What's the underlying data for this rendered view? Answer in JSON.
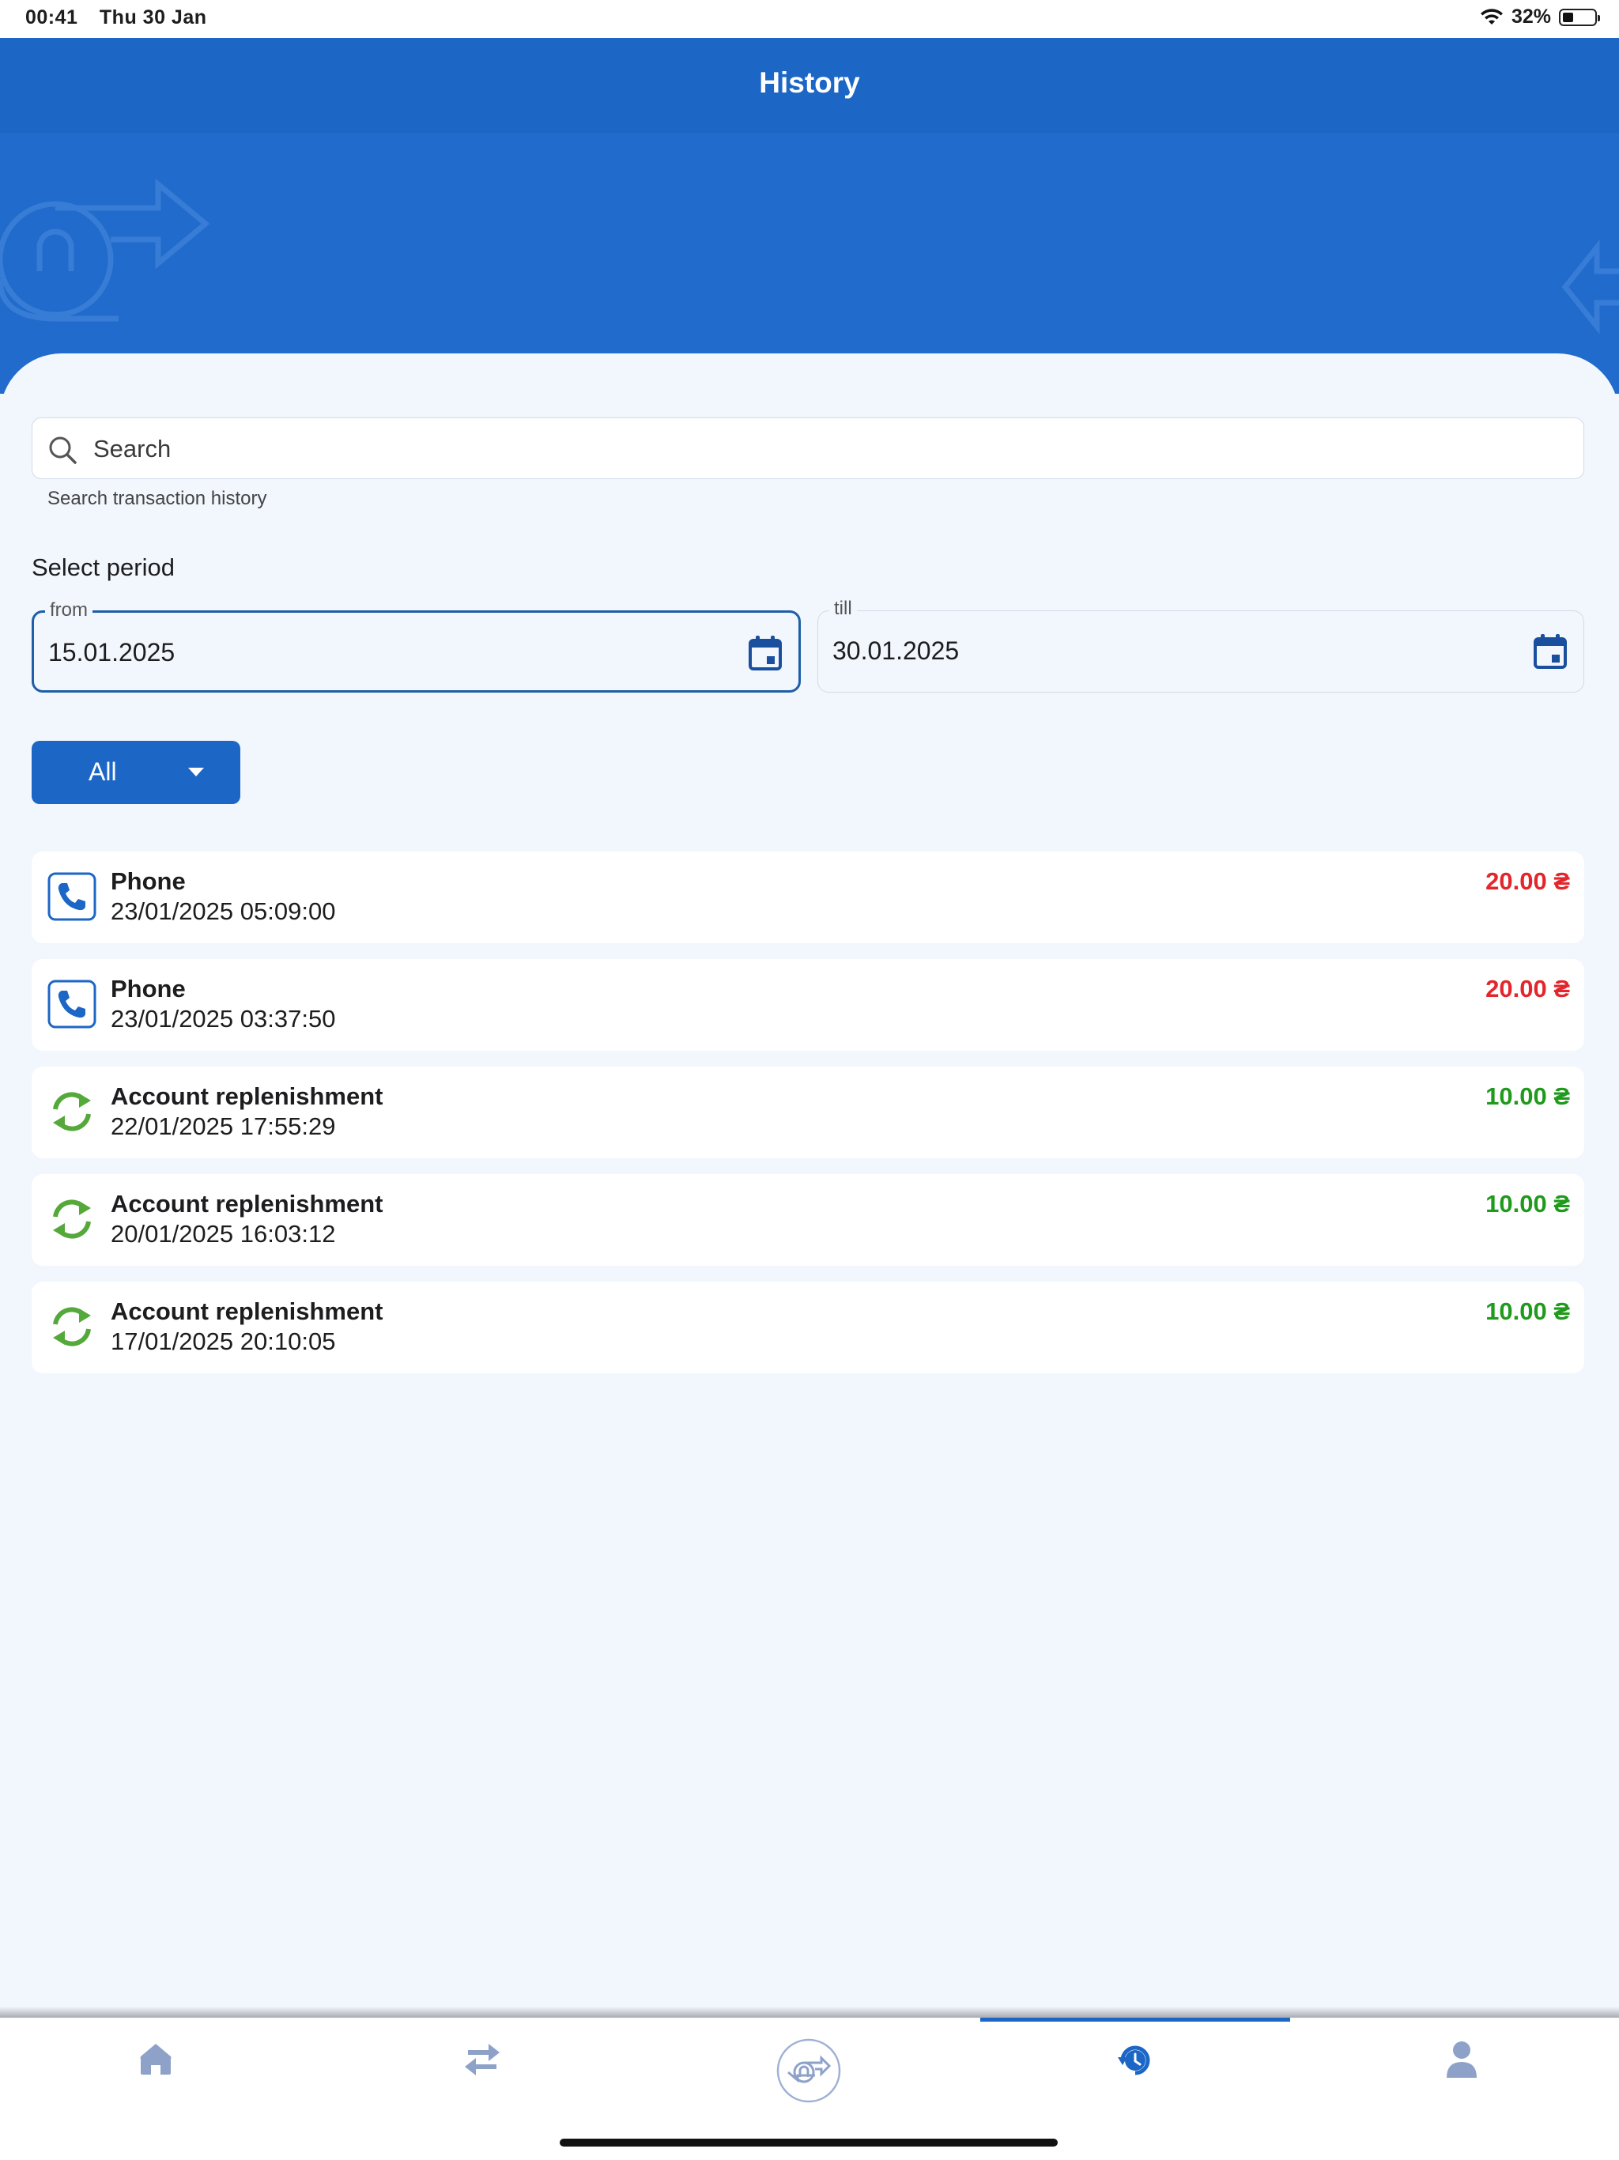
{
  "status_bar": {
    "time": "00:41",
    "date": "Thu 30 Jan",
    "battery": "32%",
    "battery_level": 0.32
  },
  "header": {
    "title": "History"
  },
  "search": {
    "placeholder": "Search",
    "value": "",
    "helper": "Search transaction history"
  },
  "period": {
    "label": "Select period",
    "from": {
      "label": "from",
      "value": "15.01.2025"
    },
    "till": {
      "label": "till",
      "value": "30.01.2025"
    }
  },
  "filter": {
    "selected": "All"
  },
  "transactions": [
    {
      "title": "Phone",
      "datetime": "23/01/2025 05:09:00",
      "amount": "20.00 ₴",
      "type": "phone",
      "sign": "negative"
    },
    {
      "title": "Phone",
      "datetime": "23/01/2025 03:37:50",
      "amount": "20.00 ₴",
      "type": "phone",
      "sign": "negative"
    },
    {
      "title": "Account replenishment",
      "datetime": "22/01/2025 17:55:29",
      "amount": "10.00 ₴",
      "type": "replenishment",
      "sign": "positive"
    },
    {
      "title": "Account replenishment",
      "datetime": "20/01/2025 16:03:12",
      "amount": "10.00 ₴",
      "type": "replenishment",
      "sign": "positive"
    },
    {
      "title": "Account replenishment",
      "datetime": "17/01/2025 20:10:05",
      "amount": "10.00 ₴",
      "type": "replenishment",
      "sign": "positive"
    }
  ],
  "nav": [
    {
      "name": "home",
      "icon": "home-icon"
    },
    {
      "name": "transfers",
      "icon": "transfer-arrows-icon"
    },
    {
      "name": "brand",
      "icon": "brand-logo-icon"
    },
    {
      "name": "history",
      "icon": "history-clock-icon",
      "active": true
    },
    {
      "name": "profile",
      "icon": "user-icon"
    }
  ],
  "colors": {
    "primary": "#1c66c6",
    "negative": "#e3262b",
    "positive": "#1f9a1c",
    "inactive_icon": "#8ea2c9"
  }
}
